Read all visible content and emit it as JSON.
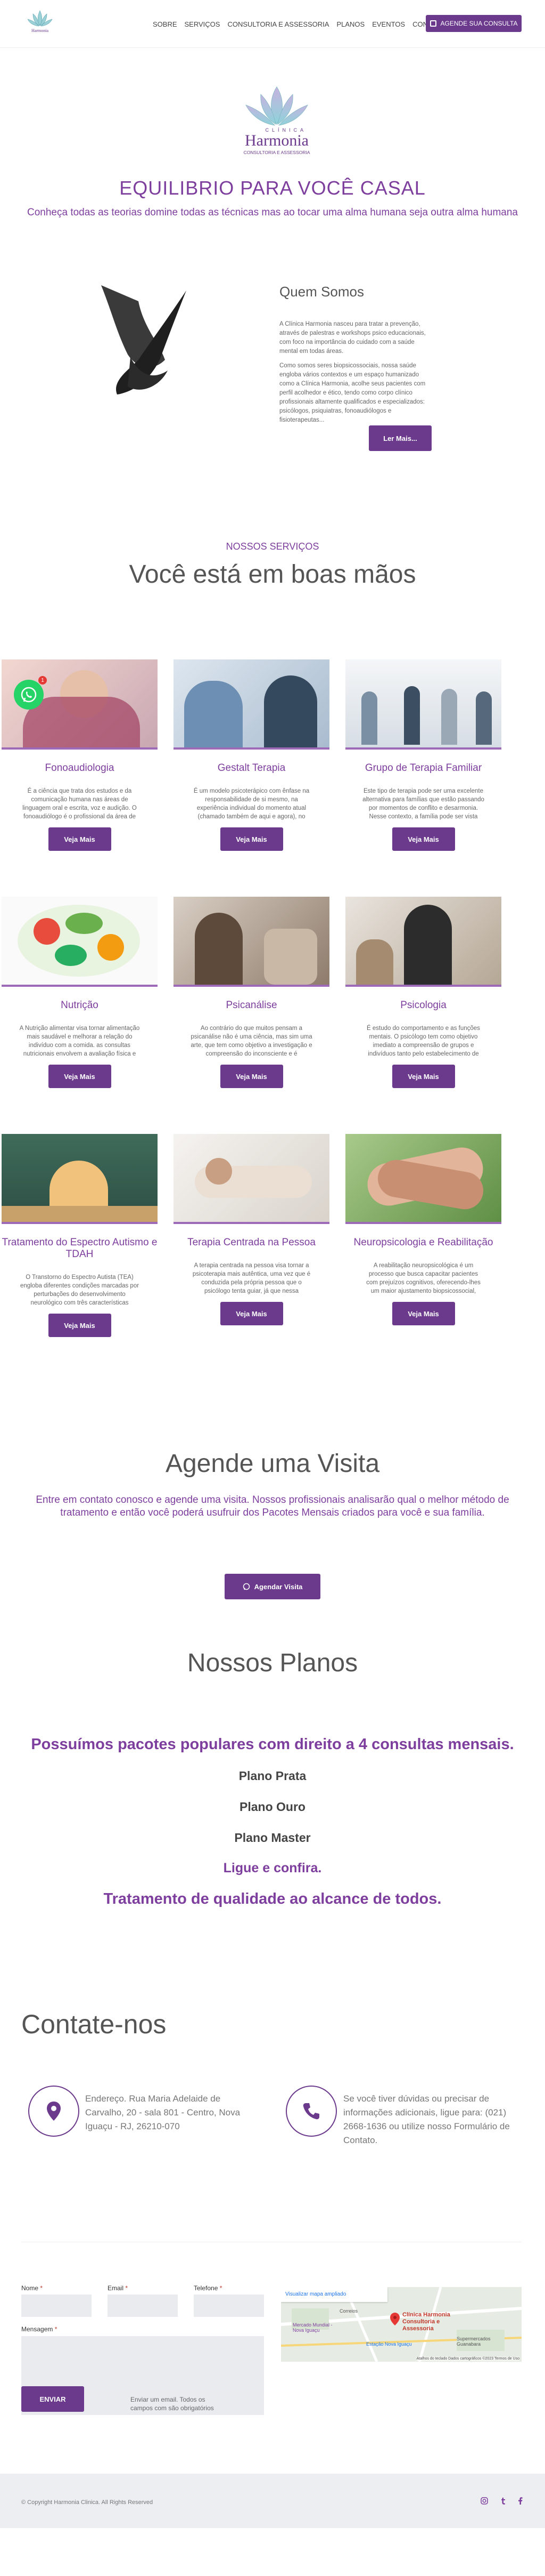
{
  "nav": {
    "items": [
      "SOBRE",
      "SERVIÇOS",
      "CONSULTORIA E ASSESSORIA",
      "PLANOS",
      "EVENTOS",
      "CONTATO"
    ],
    "cta": "AGENDE SUA CONSULTA"
  },
  "logo": {
    "line1": "CLÍNICA",
    "line2": "Harmonia",
    "line3": "CONSULTORIA E ASSESSORIA"
  },
  "hero": {
    "title": "EQUILIBRIO PARA VOCÊ CASAL",
    "subtitle": "Conheça todas as teorias domine todas as técnicas mas ao tocar uma alma humana seja outra alma humana"
  },
  "about": {
    "title": "Quem Somos",
    "p1": "A Clínica Harmonia nasceu para tratar a prevenção, através de palestras e workshops psico educacionais, com foco na importância do cuidado com a saúde mental em todas áreas.",
    "p2": "Como somos seres biopsicossociais, nossa saúde engloba vários contextos e um espaço humanizado como a Clínica Harmonia, acolhe seus pacientes com perfil acolhedor e ético, tendo como corpo clínico profissionais altamente qualificados e especializados: psicólogos, psiquiatras, fonoaudiólogos e fisioterapeutas...",
    "button": "Ler Mais..."
  },
  "services": {
    "kicker": "NOSSOS SERVIÇOS",
    "title": "Você está em boas mãos",
    "button_label": "Veja Mais",
    "cards": [
      {
        "title": "Fonoaudiologia",
        "desc": "É a ciência que trata dos estudos e da comunicação humana nas áreas de linguagem oral e escrita, voz e audição. O fonoaudiólogo é o profissional da área de saúde que estuda a comunicação e a..."
      },
      {
        "title": "Gestalt Terapia",
        "desc": "É um modelo psicoterápico com ênfase na responsabilidade de si mesmo, na experiência individual do momento atual (chamado também de aqui e agora), no relacionamento terapeuta-consulente..."
      },
      {
        "title": "Grupo de Terapia Familiar",
        "desc": "Este tipo de terapia pode ser uma excelente alternativa para famílias que estão passando por momentos de conflito e desarmonia. Nesse contexto, a família pode ser vista tanto em sua estrutura..."
      },
      {
        "title": "Nutrição",
        "desc": "A Nutrição alimentar visa tornar alimentação mais saudável e melhorar a relação do indivíduo com a comida. as consultas nutricionais envolvem a avaliação física e bioquímica, a prescrição dietoterápica e o..."
      },
      {
        "title": "Psicanálise",
        "desc": "Ao contrário do que muitos pensam a psicanálise não é uma ciência, mas sim uma arte, que tem como objetivo a investigação e compreensão do inconsciente e é considerada como uma forma de tratamento..."
      },
      {
        "title": "Psicologia",
        "desc": "É estudo do comportamento e as funções mentais. O psicólogo tem como objetivo imediato a compreensão de grupos e indivíduos tanto pelo estabelecimento de princípios universais como pelo..."
      },
      {
        "title": "Tratamento do Espectro Autismo e TDAH",
        "desc": "O Transtorno do Espectro Autista (TEA) engloba diferentes condições marcadas por perturbações do desenvolvimento neurológico com três características fundamentais, que podem manifestar-se em conjunto..."
      },
      {
        "title": "Terapia Centrada na Pessoa",
        "desc": "A terapia centrada na pessoa visa tornar a psicoterapia mais autêntica, uma vez que é conduzida pela própria pessoa que o psicólogo tenta guiar, já que nessa abordagem se acredita que possuímos o poder mesmo..."
      },
      {
        "title": "Neuropsicologia e Reabilitação",
        "desc": "A reabilitação neuropsicológica é um processo que busca capacitar pacientes com prejuízos cognitivos, oferecendo-lhes um maior ajustamento biopsicossocial, proporcionando, ao maior nível possível..."
      }
    ]
  },
  "whatsapp": {
    "badge": "1"
  },
  "agende": {
    "title": "Agende uma Visita",
    "text": "Entre em contato conosco e agende uma visita. Nossos profissionais analisarão qual o melhor método de tratamento e então você poderá usufruir dos Pacotes Mensais criados para você e sua família.",
    "button": "Agendar Visita"
  },
  "planos": {
    "title": "Nossos Planos",
    "headline": "Possuímos pacotes populares com direito a 4 consultas mensais.",
    "plans": [
      "Plano Prata",
      "Plano Ouro",
      "Plano Master"
    ],
    "cta": "Ligue e confira.",
    "tagline": "Tratamento de qualidade ao alcance de todos."
  },
  "contact": {
    "title": "Contate-nos",
    "address": "Endereço. Rua Maria Adelaide de Carvalho, 20 - sala 801 - Centro, Nova Iguaçu - RJ, 26210-070",
    "phone": "Se você tiver dúvidas ou precisar de informações adicionais, ligue para: (021) 2668-1636 ou utilize nosso Formulário de Contato.",
    "labels": {
      "name": "Nome",
      "email": "Email",
      "phone": "Telefone",
      "message": "Mensagem"
    },
    "required_mark": "*",
    "send": "ENVIAR",
    "note": "Enviar um email. Todos os campos com são obrigatórios",
    "map": {
      "link": "Visualizar mapa ampliado",
      "pin_label": "Clínica Harmonia Consultoria e Assessoria",
      "places": [
        "Correios",
        "Mercado Mundial - Nova Iguaçu",
        "Estação Nova Iguaçu",
        "Supermercados Guanabara"
      ],
      "footer": "Atalhos do teclado   Dados cartográficos ©2023   Termos de Uso"
    }
  },
  "footer": {
    "copyright": "© Copyright Harmonia Clinica. All Rights Reserved",
    "socials": [
      "instagram",
      "tumblr",
      "facebook"
    ]
  },
  "colors": {
    "accent": "#6b3a8c",
    "title": "#7d3e9e",
    "line": "#9d6ab8"
  }
}
